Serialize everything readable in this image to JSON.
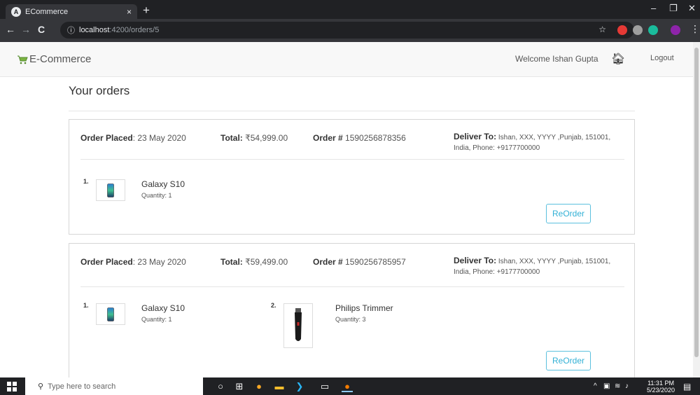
{
  "browser": {
    "tab_favicon": "A",
    "tab_title": "ECommerce",
    "tab_close": "×",
    "new_tab": "+",
    "url_host": "localhost",
    "url_path": ":4200/orders/5",
    "info_icon": "ⓘ"
  },
  "header": {
    "brand": "E-Commerce",
    "welcome": "Welcome Ishan Gupta",
    "logout": "Logout"
  },
  "page": {
    "title": "Your orders"
  },
  "orders": [
    {
      "placed_label": "Order Placed",
      "placed_value": ": 23 May 2020",
      "total_label": "Total:",
      "total_value": " ₹54,999.00",
      "order_label": "Order #",
      "order_value": " 1590256878356",
      "deliver_label": "Deliver To:",
      "deliver_value": " Ishan, XXX, YYYY ,Punjab, 151001, India, Phone: +9177700000",
      "items": [
        {
          "num": "1.",
          "name": "Galaxy S10",
          "qty": "Quantity: 1"
        }
      ],
      "reorder": "ReOrder"
    },
    {
      "placed_label": "Order Placed",
      "placed_value": ": 23 May 2020",
      "total_label": "Total:",
      "total_value": " ₹59,499.00",
      "order_label": "Order #",
      "order_value": " 1590256785957",
      "deliver_label": "Deliver To:",
      "deliver_value": " Ishan, XXX, YYYY ,Punjab, 151001, India, Phone: +9177700000",
      "items": [
        {
          "num": "1.",
          "name": "Galaxy S10",
          "qty": "Quantity: 1"
        },
        {
          "num": "2.",
          "name": "Philips Trimmer",
          "qty": "Quantity: 3"
        }
      ],
      "reorder": "ReOrder"
    }
  ],
  "taskbar": {
    "search_placeholder": "Type here to search",
    "time": "11:31 PM",
    "date": "5/23/2020"
  },
  "colors": {
    "accent": "#5bc0de",
    "chrome_dark": "#202124",
    "chrome_mid": "#35363a"
  }
}
